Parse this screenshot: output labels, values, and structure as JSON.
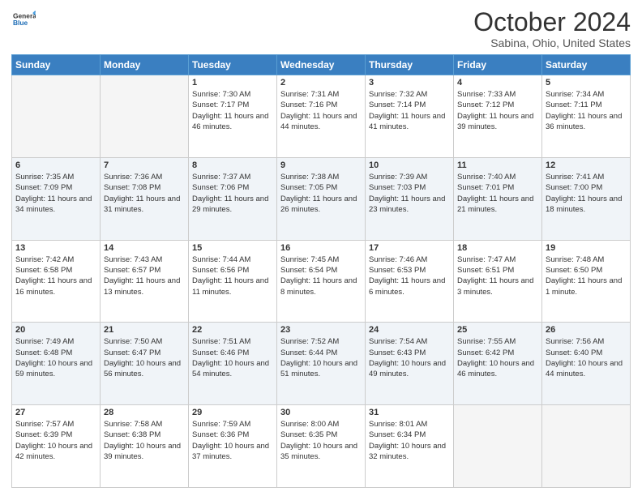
{
  "header": {
    "logo": {
      "line1": "General",
      "line2": "Blue",
      "icon_color": "#1a6bb5"
    },
    "title": "October 2024",
    "subtitle": "Sabina, Ohio, United States"
  },
  "days_of_week": [
    "Sunday",
    "Monday",
    "Tuesday",
    "Wednesday",
    "Thursday",
    "Friday",
    "Saturday"
  ],
  "weeks": [
    {
      "days": [
        {
          "num": "",
          "empty": true
        },
        {
          "num": "",
          "empty": true
        },
        {
          "num": "1",
          "sunrise": "Sunrise: 7:30 AM",
          "sunset": "Sunset: 7:17 PM",
          "daylight": "Daylight: 11 hours and 46 minutes."
        },
        {
          "num": "2",
          "sunrise": "Sunrise: 7:31 AM",
          "sunset": "Sunset: 7:16 PM",
          "daylight": "Daylight: 11 hours and 44 minutes."
        },
        {
          "num": "3",
          "sunrise": "Sunrise: 7:32 AM",
          "sunset": "Sunset: 7:14 PM",
          "daylight": "Daylight: 11 hours and 41 minutes."
        },
        {
          "num": "4",
          "sunrise": "Sunrise: 7:33 AM",
          "sunset": "Sunset: 7:12 PM",
          "daylight": "Daylight: 11 hours and 39 minutes."
        },
        {
          "num": "5",
          "sunrise": "Sunrise: 7:34 AM",
          "sunset": "Sunset: 7:11 PM",
          "daylight": "Daylight: 11 hours and 36 minutes."
        }
      ]
    },
    {
      "shaded": true,
      "days": [
        {
          "num": "6",
          "sunrise": "Sunrise: 7:35 AM",
          "sunset": "Sunset: 7:09 PM",
          "daylight": "Daylight: 11 hours and 34 minutes."
        },
        {
          "num": "7",
          "sunrise": "Sunrise: 7:36 AM",
          "sunset": "Sunset: 7:08 PM",
          "daylight": "Daylight: 11 hours and 31 minutes."
        },
        {
          "num": "8",
          "sunrise": "Sunrise: 7:37 AM",
          "sunset": "Sunset: 7:06 PM",
          "daylight": "Daylight: 11 hours and 29 minutes."
        },
        {
          "num": "9",
          "sunrise": "Sunrise: 7:38 AM",
          "sunset": "Sunset: 7:05 PM",
          "daylight": "Daylight: 11 hours and 26 minutes."
        },
        {
          "num": "10",
          "sunrise": "Sunrise: 7:39 AM",
          "sunset": "Sunset: 7:03 PM",
          "daylight": "Daylight: 11 hours and 23 minutes."
        },
        {
          "num": "11",
          "sunrise": "Sunrise: 7:40 AM",
          "sunset": "Sunset: 7:01 PM",
          "daylight": "Daylight: 11 hours and 21 minutes."
        },
        {
          "num": "12",
          "sunrise": "Sunrise: 7:41 AM",
          "sunset": "Sunset: 7:00 PM",
          "daylight": "Daylight: 11 hours and 18 minutes."
        }
      ]
    },
    {
      "days": [
        {
          "num": "13",
          "sunrise": "Sunrise: 7:42 AM",
          "sunset": "Sunset: 6:58 PM",
          "daylight": "Daylight: 11 hours and 16 minutes."
        },
        {
          "num": "14",
          "sunrise": "Sunrise: 7:43 AM",
          "sunset": "Sunset: 6:57 PM",
          "daylight": "Daylight: 11 hours and 13 minutes."
        },
        {
          "num": "15",
          "sunrise": "Sunrise: 7:44 AM",
          "sunset": "Sunset: 6:56 PM",
          "daylight": "Daylight: 11 hours and 11 minutes."
        },
        {
          "num": "16",
          "sunrise": "Sunrise: 7:45 AM",
          "sunset": "Sunset: 6:54 PM",
          "daylight": "Daylight: 11 hours and 8 minutes."
        },
        {
          "num": "17",
          "sunrise": "Sunrise: 7:46 AM",
          "sunset": "Sunset: 6:53 PM",
          "daylight": "Daylight: 11 hours and 6 minutes."
        },
        {
          "num": "18",
          "sunrise": "Sunrise: 7:47 AM",
          "sunset": "Sunset: 6:51 PM",
          "daylight": "Daylight: 11 hours and 3 minutes."
        },
        {
          "num": "19",
          "sunrise": "Sunrise: 7:48 AM",
          "sunset": "Sunset: 6:50 PM",
          "daylight": "Daylight: 11 hours and 1 minute."
        }
      ]
    },
    {
      "shaded": true,
      "days": [
        {
          "num": "20",
          "sunrise": "Sunrise: 7:49 AM",
          "sunset": "Sunset: 6:48 PM",
          "daylight": "Daylight: 10 hours and 59 minutes."
        },
        {
          "num": "21",
          "sunrise": "Sunrise: 7:50 AM",
          "sunset": "Sunset: 6:47 PM",
          "daylight": "Daylight: 10 hours and 56 minutes."
        },
        {
          "num": "22",
          "sunrise": "Sunrise: 7:51 AM",
          "sunset": "Sunset: 6:46 PM",
          "daylight": "Daylight: 10 hours and 54 minutes."
        },
        {
          "num": "23",
          "sunrise": "Sunrise: 7:52 AM",
          "sunset": "Sunset: 6:44 PM",
          "daylight": "Daylight: 10 hours and 51 minutes."
        },
        {
          "num": "24",
          "sunrise": "Sunrise: 7:54 AM",
          "sunset": "Sunset: 6:43 PM",
          "daylight": "Daylight: 10 hours and 49 minutes."
        },
        {
          "num": "25",
          "sunrise": "Sunrise: 7:55 AM",
          "sunset": "Sunset: 6:42 PM",
          "daylight": "Daylight: 10 hours and 46 minutes."
        },
        {
          "num": "26",
          "sunrise": "Sunrise: 7:56 AM",
          "sunset": "Sunset: 6:40 PM",
          "daylight": "Daylight: 10 hours and 44 minutes."
        }
      ]
    },
    {
      "days": [
        {
          "num": "27",
          "sunrise": "Sunrise: 7:57 AM",
          "sunset": "Sunset: 6:39 PM",
          "daylight": "Daylight: 10 hours and 42 minutes."
        },
        {
          "num": "28",
          "sunrise": "Sunrise: 7:58 AM",
          "sunset": "Sunset: 6:38 PM",
          "daylight": "Daylight: 10 hours and 39 minutes."
        },
        {
          "num": "29",
          "sunrise": "Sunrise: 7:59 AM",
          "sunset": "Sunset: 6:36 PM",
          "daylight": "Daylight: 10 hours and 37 minutes."
        },
        {
          "num": "30",
          "sunrise": "Sunrise: 8:00 AM",
          "sunset": "Sunset: 6:35 PM",
          "daylight": "Daylight: 10 hours and 35 minutes."
        },
        {
          "num": "31",
          "sunrise": "Sunrise: 8:01 AM",
          "sunset": "Sunset: 6:34 PM",
          "daylight": "Daylight: 10 hours and 32 minutes."
        },
        {
          "num": "",
          "empty": true
        },
        {
          "num": "",
          "empty": true
        }
      ]
    }
  ]
}
